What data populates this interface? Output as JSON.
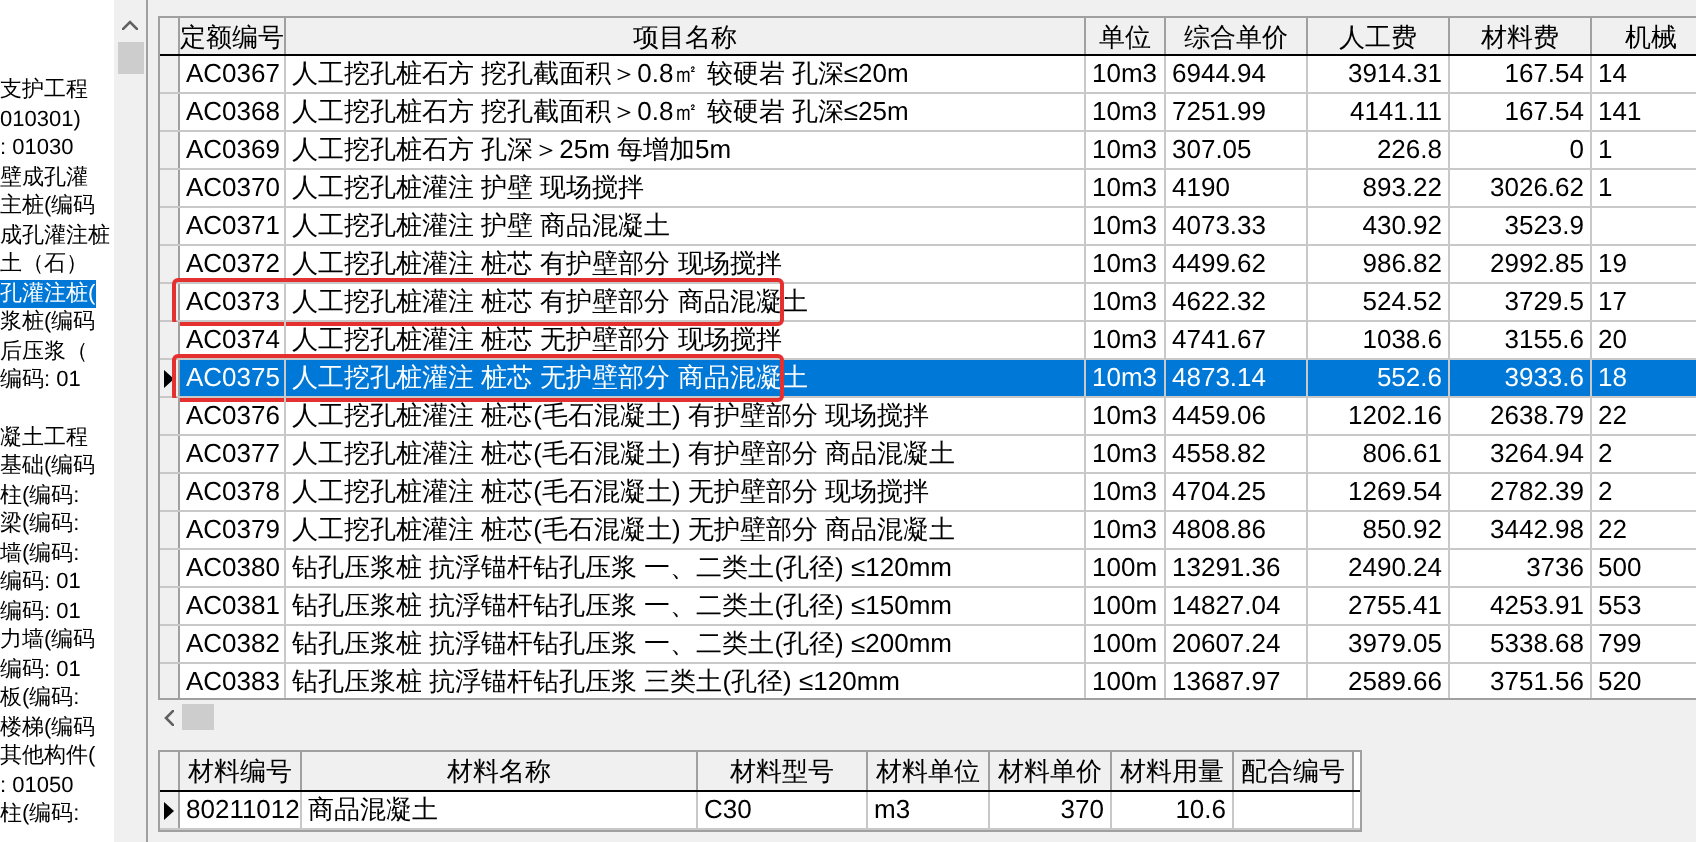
{
  "tree": {
    "items": [
      {
        "label": "支护工程",
        "selected": false
      },
      {
        "label": "010301)",
        "selected": false
      },
      {
        "label": ": 01030",
        "selected": false
      },
      {
        "label": "壁成孔灌",
        "selected": false
      },
      {
        "label": "主桩(编码",
        "selected": false
      },
      {
        "label": "成孔灌注桩",
        "selected": false
      },
      {
        "label": "土（石）",
        "selected": false
      },
      {
        "label": "孔灌注桩(",
        "selected": true
      },
      {
        "label": "浆桩(编码",
        "selected": false
      },
      {
        "label": "后压浆（",
        "selected": false
      },
      {
        "label": "编码: 01",
        "selected": false
      },
      {
        "label": "凝土工程",
        "selected": false
      },
      {
        "label": "基础(编码",
        "selected": false
      },
      {
        "label": "柱(编码:",
        "selected": false
      },
      {
        "label": "梁(编码:",
        "selected": false
      },
      {
        "label": "墙(编码:",
        "selected": false
      },
      {
        "label": "编码: 01",
        "selected": false
      },
      {
        "label": "编码: 01",
        "selected": false
      },
      {
        "label": "力墙(编码",
        "selected": false
      },
      {
        "label": "编码: 01",
        "selected": false
      },
      {
        "label": "板(编码:",
        "selected": false
      },
      {
        "label": "楼梯(编码",
        "selected": false
      },
      {
        "label": "其他构件(",
        "selected": false
      },
      {
        "label": ": 01050",
        "selected": false
      },
      {
        "label": "柱(编码:",
        "selected": false
      }
    ]
  },
  "quota_table": {
    "columns": [
      "定额编号",
      "项目名称",
      "单位",
      "综合单价",
      "人工费",
      "材料费",
      "机械"
    ],
    "rows": [
      {
        "cells": [
          "AC0367",
          "人工挖孔桩石方 挖孔截面积＞0.8㎡ 较硬岩 孔深≤20m",
          "10m3",
          "6944.94",
          "3914.31",
          "167.54",
          "14"
        ],
        "selected": false,
        "annotated": false
      },
      {
        "cells": [
          "AC0368",
          "人工挖孔桩石方 挖孔截面积＞0.8㎡ 较硬岩 孔深≤25m",
          "10m3",
          "7251.99",
          "4141.11",
          "167.54",
          "141"
        ],
        "selected": false,
        "annotated": false
      },
      {
        "cells": [
          "AC0369",
          "人工挖孔桩石方 孔深＞25m 每增加5m",
          "10m3",
          "307.05",
          "226.8",
          "0",
          "1"
        ],
        "selected": false,
        "annotated": false
      },
      {
        "cells": [
          "AC0370",
          "人工挖孔桩灌注 护壁 现场搅拌",
          "10m3",
          "4190",
          "893.22",
          "3026.62",
          "1"
        ],
        "selected": false,
        "annotated": false
      },
      {
        "cells": [
          "AC0371",
          "人工挖孔桩灌注 护壁 商品混凝土",
          "10m3",
          "4073.33",
          "430.92",
          "3523.9",
          ""
        ],
        "selected": false,
        "annotated": false
      },
      {
        "cells": [
          "AC0372",
          "人工挖孔桩灌注 桩芯 有护壁部分 现场搅拌",
          "10m3",
          "4499.62",
          "986.82",
          "2992.85",
          "19"
        ],
        "selected": false,
        "annotated": false
      },
      {
        "cells": [
          "AC0373",
          "人工挖孔桩灌注 桩芯 有护壁部分 商品混凝土",
          "10m3",
          "4622.32",
          "524.52",
          "3729.5",
          "17"
        ],
        "selected": false,
        "annotated": true
      },
      {
        "cells": [
          "AC0374",
          "人工挖孔桩灌注 桩芯 无护壁部分 现场搅拌",
          "10m3",
          "4741.67",
          "1038.6",
          "3155.6",
          "20"
        ],
        "selected": false,
        "annotated": false
      },
      {
        "cells": [
          "AC0375",
          "人工挖孔桩灌注 桩芯 无护壁部分 商品混凝土",
          "10m3",
          "4873.14",
          "552.6",
          "3933.6",
          "18"
        ],
        "selected": true,
        "annotated": true
      },
      {
        "cells": [
          "AC0376",
          "人工挖孔桩灌注 桩芯(毛石混凝土) 有护壁部分 现场搅拌",
          "10m3",
          "4459.06",
          "1202.16",
          "2638.79",
          "22"
        ],
        "selected": false,
        "annotated": false
      },
      {
        "cells": [
          "AC0377",
          "人工挖孔桩灌注 桩芯(毛石混凝土) 有护壁部分 商品混凝土",
          "10m3",
          "4558.82",
          "806.61",
          "3264.94",
          "2"
        ],
        "selected": false,
        "annotated": false
      },
      {
        "cells": [
          "AC0378",
          "人工挖孔桩灌注 桩芯(毛石混凝土) 无护壁部分 现场搅拌",
          "10m3",
          "4704.25",
          "1269.54",
          "2782.39",
          "2"
        ],
        "selected": false,
        "annotated": false
      },
      {
        "cells": [
          "AC0379",
          "人工挖孔桩灌注 桩芯(毛石混凝土) 无护壁部分 商品混凝土",
          "10m3",
          "4808.86",
          "850.92",
          "3442.98",
          "22"
        ],
        "selected": false,
        "annotated": false
      },
      {
        "cells": [
          "AC0380",
          "钻孔压浆桩 抗浮锚杆钻孔压浆 一、二类土(孔径) ≤120mm",
          "100m",
          "13291.36",
          "2490.24",
          "3736",
          "500"
        ],
        "selected": false,
        "annotated": false
      },
      {
        "cells": [
          "AC0381",
          "钻孔压浆桩 抗浮锚杆钻孔压浆 一、二类土(孔径) ≤150mm",
          "100m",
          "14827.04",
          "2755.41",
          "4253.91",
          "553"
        ],
        "selected": false,
        "annotated": false
      },
      {
        "cells": [
          "AC0382",
          "钻孔压浆桩 抗浮锚杆钻孔压浆 一、二类土(孔径) ≤200mm",
          "100m",
          "20607.24",
          "3979.05",
          "5338.68",
          "799"
        ],
        "selected": false,
        "annotated": false
      },
      {
        "cells": [
          "AC0383",
          "钻孔压浆桩 抗浮锚杆钻孔压浆 三类土(孔径) ≤120mm",
          "100m",
          "13687.97",
          "2589.66",
          "3751.56",
          "520"
        ],
        "selected": false,
        "annotated": false
      }
    ]
  },
  "material_table": {
    "columns": [
      "材料编号",
      "材料名称",
      "材料型号",
      "材料单位",
      "材料单价",
      "材料用量",
      "配合编号"
    ],
    "rows": [
      {
        "cells": [
          "80211012",
          "商品混凝土",
          "C30",
          "m3",
          "370",
          "10.6",
          ""
        ],
        "selected": true
      }
    ]
  }
}
